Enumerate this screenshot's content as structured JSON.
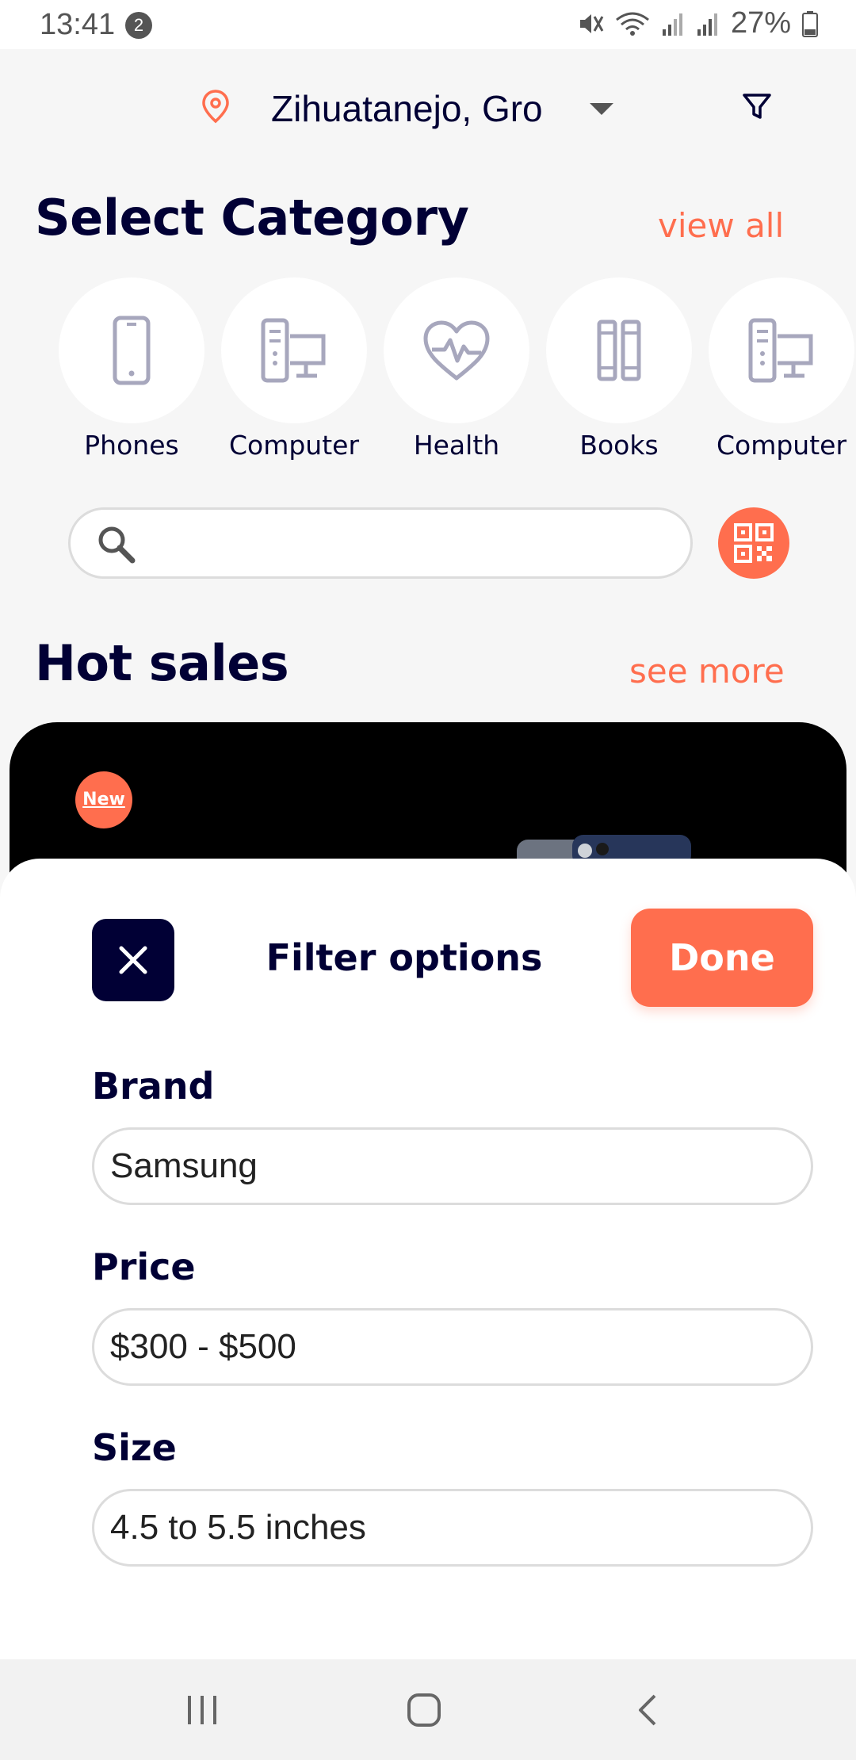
{
  "status_bar": {
    "time": "13:41",
    "notification_count": "2",
    "battery": "27%"
  },
  "header": {
    "location": "Zihuatanejo, Gro",
    "icons": [
      "location-pin-icon",
      "caret-down-icon",
      "filter-icon"
    ]
  },
  "categories": {
    "title": "Select Category",
    "view_all": "view all",
    "items": [
      {
        "label": "Phones",
        "icon": "phone-icon"
      },
      {
        "label": "Computer",
        "icon": "computer-icon"
      },
      {
        "label": "Health",
        "icon": "heart-pulse-icon"
      },
      {
        "label": "Books",
        "icon": "books-icon"
      },
      {
        "label": "Computer",
        "icon": "computer-icon"
      }
    ]
  },
  "search": {
    "placeholder": "",
    "value": ""
  },
  "hot_sales": {
    "title": "Hot sales",
    "see_more": "see more",
    "badge": "New"
  },
  "filter_sheet": {
    "title": "Filter options",
    "done_label": "Done",
    "fields": [
      {
        "label": "Brand",
        "value": "Samsung"
      },
      {
        "label": "Price",
        "value": "$300 - $500"
      },
      {
        "label": "Size",
        "value": "4.5 to 5.5 inches"
      }
    ]
  },
  "colors": {
    "accent": "#ff6e4e",
    "navy": "#010035",
    "background": "#f6f6f6"
  }
}
